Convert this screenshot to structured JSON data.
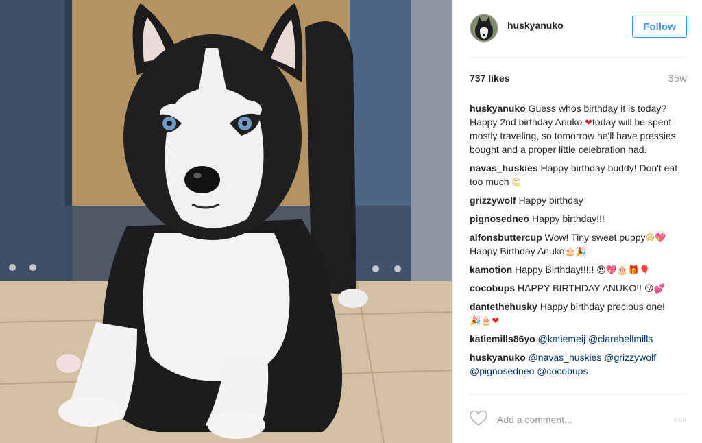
{
  "post": {
    "username": "huskyanuko",
    "follow_label": "Follow",
    "likes": "737 likes",
    "age": "35w",
    "add_comment_placeholder": "Add a comment...",
    "more_glyph": "○○○"
  },
  "caption": {
    "user": "huskyanuko",
    "text_1": "Guess whos birthday it is today? Happy 2nd birthday Anuko ",
    "emoji_1": "❤",
    "text_2": "today will be spent mostly traveling, so tomorrow he'll have pressies bought and a proper little celebration had."
  },
  "comments": [
    {
      "user": "navas_huskies",
      "text": "Happy birthday buddy! Don't eat too much ",
      "emoji": "😉"
    },
    {
      "user": "grizzywolf",
      "text": "Happy birthday",
      "emoji": ""
    },
    {
      "user": "pignosedneo",
      "text": "Happy birthday!!!",
      "emoji": ""
    },
    {
      "user": "alfonsbuttercup",
      "text": "Wow! Tiny sweet puppy",
      "emoji": "😆💖",
      "text_2": "Happy Birthday Anuko",
      "emoji_2": "🎂🎉"
    },
    {
      "user": "kamotion",
      "text": "Happy Birthday!!!!! ",
      "emoji": "😍💖🎂🎁🎈"
    },
    {
      "user": "cocobups",
      "text": "HAPPY BIRTHDAY ANUKO!! ",
      "emoji": "😘💕"
    },
    {
      "user": "dantethehusky",
      "text": "Happy birthday precious one! ",
      "emoji": "🎉🎂❤"
    },
    {
      "user": "katiemills86yo",
      "mentions": [
        "@katiemeij",
        "@clarebellmills"
      ]
    },
    {
      "user": "huskyanuko",
      "mentions": [
        "@navas_huskies",
        "@grizzywolf",
        "@pignosedneo",
        "@cocobups"
      ]
    }
  ],
  "colors": {
    "follow_blue": "#3897f0",
    "mention_blue": "#003569",
    "muted_gray": "#999999",
    "heart_red": "#e0262e"
  },
  "icons": {
    "like": "heart-outline-icon",
    "more": "more-options-icon"
  }
}
